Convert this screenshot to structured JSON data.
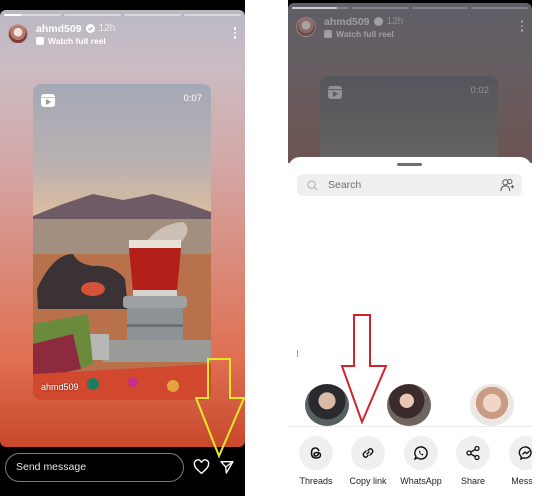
{
  "left_screen": {
    "story": {
      "progress_segments": 4,
      "progress_current_fraction": 0.3,
      "username": "ahmd509",
      "verified": true,
      "time_ago": "12h",
      "watch_full_reel": "Watch full reel",
      "more_icon": "more-vertical-icon"
    },
    "reel": {
      "duration": "0:07",
      "author": "ahmd509",
      "description": "Photo of a glass of red tea on a stove in a desert with a mountain at sunset"
    },
    "bottom_bar": {
      "message_placeholder": "Send message",
      "like_icon": "heart-icon",
      "share_icon": "send-icon"
    },
    "annotation": {
      "color": "#e4e829",
      "points_to": "send-icon"
    }
  },
  "right_screen": {
    "story": {
      "username": "ahmd509",
      "time_ago": "12h",
      "watch_full_reel": "Watch full reel",
      "duration": "0:02"
    },
    "share_sheet": {
      "search_placeholder": "Search",
      "contacts": [
        {
          "name": ""
        },
        {
          "name": ""
        },
        {
          "name": ""
        }
      ],
      "actions": [
        {
          "label": "Threads",
          "icon": "threads-icon"
        },
        {
          "label": "Copy link",
          "icon": "link-icon"
        },
        {
          "label": "WhatsApp",
          "icon": "whatsapp-icon"
        },
        {
          "label": "Share",
          "icon": "share-icon"
        },
        {
          "label": "Messer",
          "icon": "messenger-icon"
        }
      ]
    },
    "annotation": {
      "color": "#d3232a",
      "points_to": "copy-link-button"
    }
  }
}
